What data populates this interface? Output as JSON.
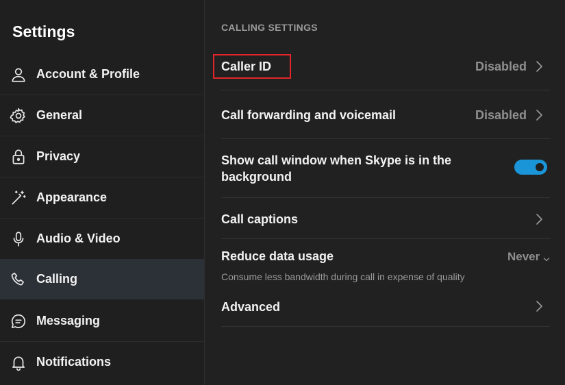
{
  "sidebar": {
    "title": "Settings",
    "items": [
      {
        "label": "Account & Profile",
        "icon": "person-icon",
        "active": false
      },
      {
        "label": "General",
        "icon": "gear-icon",
        "active": false
      },
      {
        "label": "Privacy",
        "icon": "lock-icon",
        "active": false
      },
      {
        "label": "Appearance",
        "icon": "magic-wand-icon",
        "active": false
      },
      {
        "label": "Audio & Video",
        "icon": "microphone-icon",
        "active": false
      },
      {
        "label": "Calling",
        "icon": "phone-icon",
        "active": true
      },
      {
        "label": "Messaging",
        "icon": "chat-bubble-icon",
        "active": false
      },
      {
        "label": "Notifications",
        "icon": "bell-icon",
        "active": false
      }
    ]
  },
  "main": {
    "section_title": "CALLING SETTINGS",
    "caller_id": {
      "label": "Caller ID",
      "value": "Disabled"
    },
    "call_forwarding": {
      "label": "Call forwarding and voicemail",
      "value": "Disabled"
    },
    "show_call_window": {
      "label_line1": "Show call window when Skype is in the",
      "label_line2": "background",
      "enabled": true
    },
    "call_captions": {
      "label": "Call captions"
    },
    "reduce_data": {
      "label": "Reduce data usage",
      "value": "Never",
      "description": "Consume less bandwidth during call in expense of quality"
    },
    "advanced": {
      "label": "Advanced"
    }
  },
  "colors": {
    "accent": "#1a96d8",
    "highlight": "#e0262b",
    "active_nav": "#2c3137"
  }
}
